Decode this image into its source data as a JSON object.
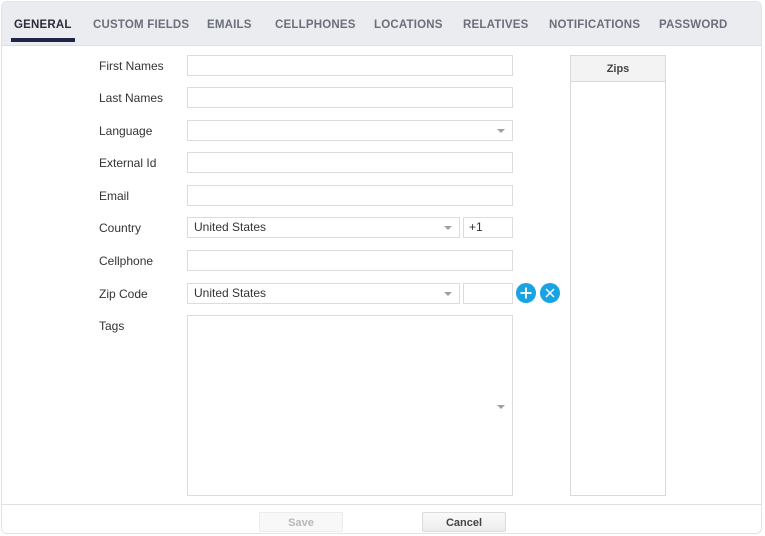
{
  "tabs": [
    {
      "label": "GENERAL",
      "active": true
    },
    {
      "label": "CUSTOM FIELDS",
      "active": false
    },
    {
      "label": "EMAILS",
      "active": false
    },
    {
      "label": "CELLPHONES",
      "active": false
    },
    {
      "label": "LOCATIONS",
      "active": false
    },
    {
      "label": "RELATIVES",
      "active": false
    },
    {
      "label": "NOTIFICATIONS",
      "active": false
    },
    {
      "label": "PASSWORD",
      "active": false
    }
  ],
  "form": {
    "first_names": {
      "label": "First Names",
      "value": ""
    },
    "last_names": {
      "label": "Last Names",
      "value": ""
    },
    "language": {
      "label": "Language",
      "value": ""
    },
    "external_id": {
      "label": "External Id",
      "value": ""
    },
    "email": {
      "label": "Email",
      "value": ""
    },
    "country": {
      "label": "Country",
      "value": "United States",
      "dial_code": "+1"
    },
    "cellphone": {
      "label": "Cellphone",
      "value": ""
    },
    "zip_code": {
      "label": "Zip Code",
      "country": "United States",
      "value": ""
    },
    "tags": {
      "label": "Tags",
      "value": ""
    }
  },
  "zips": {
    "header": "Zips",
    "items": []
  },
  "icons": {
    "add": "plus-icon",
    "remove": "close-icon",
    "dropdown": "caret-down-icon"
  },
  "colors": {
    "accent": "#1aa3e2",
    "tab_underline": "#1f2547",
    "tab_bar_bg": "#ebecef"
  },
  "footer": {
    "save_label": "Save",
    "cancel_label": "Cancel",
    "save_disabled": true
  }
}
